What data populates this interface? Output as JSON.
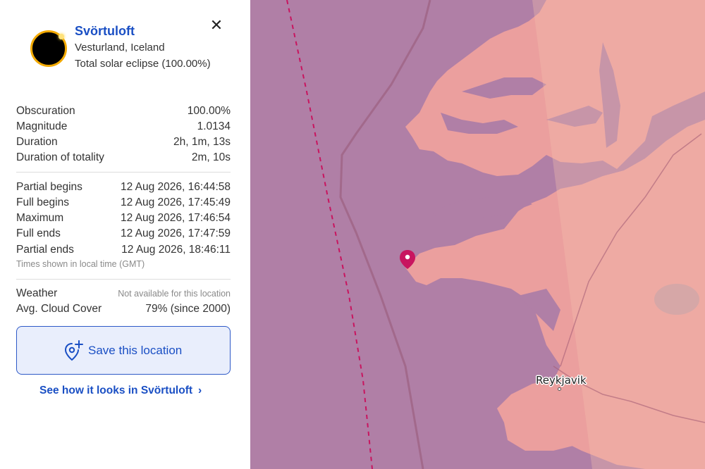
{
  "location": {
    "name": "Svörtuloft",
    "region": "Vesturland, Iceland",
    "eclipse_type": "Total solar eclipse (100.00%)"
  },
  "icons": {
    "close": "close-icon",
    "eclipse": "eclipse-icon",
    "save": "map-pin-plus-icon",
    "chevron": "chevron-right-icon"
  },
  "stats": [
    {
      "label": "Obscuration",
      "value": "100.00%"
    },
    {
      "label": "Magnitude",
      "value": "1.0134"
    },
    {
      "label": "Duration",
      "value": "2h, 1m, 13s"
    },
    {
      "label": "Duration of totality",
      "value": "2m, 10s"
    }
  ],
  "times": [
    {
      "label": "Partial begins",
      "value": "12 Aug 2026, 16:44:58"
    },
    {
      "label": "Full begins",
      "value": "12 Aug 2026, 17:45:49"
    },
    {
      "label": "Maximum",
      "value": "12 Aug 2026, 17:46:54"
    },
    {
      "label": "Full ends",
      "value": "12 Aug 2026, 17:47:59"
    },
    {
      "label": "Partial ends",
      "value": "12 Aug 2026, 18:46:11"
    }
  ],
  "times_note": "Times shown in local time (GMT)",
  "weather": {
    "label": "Weather",
    "value": "Not available for this location",
    "cloud_label": "Avg. Cloud Cover",
    "cloud_value": "79% (since 2000)"
  },
  "actions": {
    "save_label": "Save this location",
    "see_label": "See how it looks in Svörtuloft",
    "chevron": "›"
  },
  "map": {
    "city": "Reykjavik",
    "colors": {
      "sea": "#ae7ba3",
      "land": "#eca39f",
      "pin": "#c8155f",
      "path_band": "#f0aa9d"
    }
  }
}
